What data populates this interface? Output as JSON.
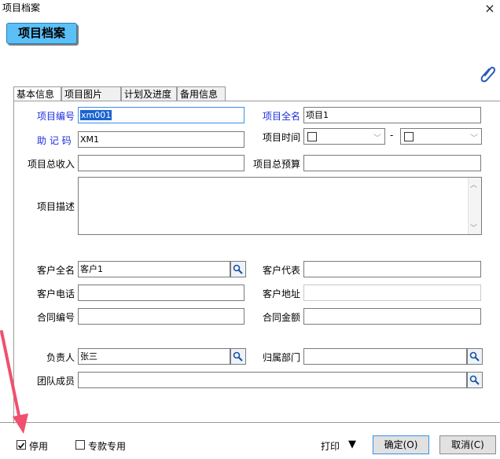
{
  "window": {
    "title": "项目档案",
    "close_glyph": "×"
  },
  "header": {
    "label": "项目档案"
  },
  "tabs": [
    {
      "label": "基本信息"
    },
    {
      "label": "项目图片"
    },
    {
      "label": "计划及进度"
    },
    {
      "label": "备用信息"
    }
  ],
  "form": {
    "project_code": {
      "label": "项目编号",
      "value": "xm001"
    },
    "project_fullname": {
      "label": "项目全名",
      "value": "项目1"
    },
    "mnemonic": {
      "label": "助 记 码",
      "value": "XM1"
    },
    "project_time": {
      "label": "项目时间",
      "separator": "-"
    },
    "total_income": {
      "label": "项目总收入",
      "value": ""
    },
    "total_budget": {
      "label": "项目总预算",
      "value": ""
    },
    "description": {
      "label": "项目描述",
      "value": ""
    },
    "customer_fullname": {
      "label": "客户全名",
      "value": "客户1"
    },
    "customer_rep": {
      "label": "客户代表",
      "value": ""
    },
    "customer_phone": {
      "label": "客户电话",
      "value": ""
    },
    "customer_address": {
      "label": "客户地址",
      "value": ""
    },
    "contract_no": {
      "label": "合同编号",
      "value": ""
    },
    "contract_amount": {
      "label": "合同金额",
      "value": ""
    },
    "manager": {
      "label": "负责人",
      "value": "张三"
    },
    "department": {
      "label": "归属部门",
      "value": ""
    },
    "team_members": {
      "label": "团队成员",
      "value": ""
    }
  },
  "footer": {
    "disable": {
      "label": "停用",
      "checked": true
    },
    "dedicated_fund": {
      "label": "专款专用",
      "checked": false
    },
    "print_label": "打印",
    "print_arrow": "▼",
    "ok_label": "确定(O)",
    "cancel_label": "取消(C)"
  },
  "colors": {
    "header_bg": "#5bc0f8",
    "required_label": "#1b2fdc",
    "annotation_arrow": "#f0506e"
  }
}
